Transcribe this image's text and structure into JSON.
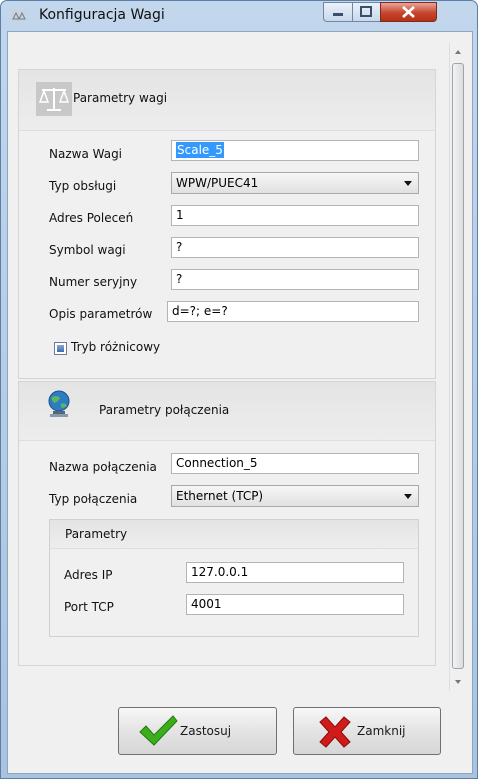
{
  "window": {
    "title": "Konfiguracja Wagi"
  },
  "scale_params": {
    "header": "Parametry wagi",
    "labels": {
      "name": "Nazwa Wagi",
      "type": "Typ obsługi",
      "address": "Adres Poleceń",
      "symbol": "Symbol wagi",
      "serial": "Numer seryjny",
      "desc": "Opis parametrów"
    },
    "values": {
      "name": "Scale_5",
      "type": "WPW/PUEC41",
      "address": "1",
      "symbol": "?",
      "serial": "?",
      "desc": "d=?; e=?"
    },
    "diff_mode": {
      "label": "Tryb różnicowy",
      "checked": true
    }
  },
  "connection_params": {
    "header": "Parametry połączenia",
    "labels": {
      "name": "Nazwa połączenia",
      "type": "Typ połączenia"
    },
    "values": {
      "name": "Connection_5",
      "type": "Ethernet (TCP)"
    },
    "sub": {
      "header": "Parametry",
      "labels": {
        "ip": "Adres IP",
        "port": "Port TCP"
      },
      "values": {
        "ip": "127.0.0.1",
        "port": "4001"
      }
    }
  },
  "buttons": {
    "apply": "Zastosuj",
    "close": "Zamknij"
  },
  "colors": {
    "accent_selection": "#3399ff",
    "apply_icon": "#3cae1c",
    "close_icon": "#d11a1a"
  }
}
